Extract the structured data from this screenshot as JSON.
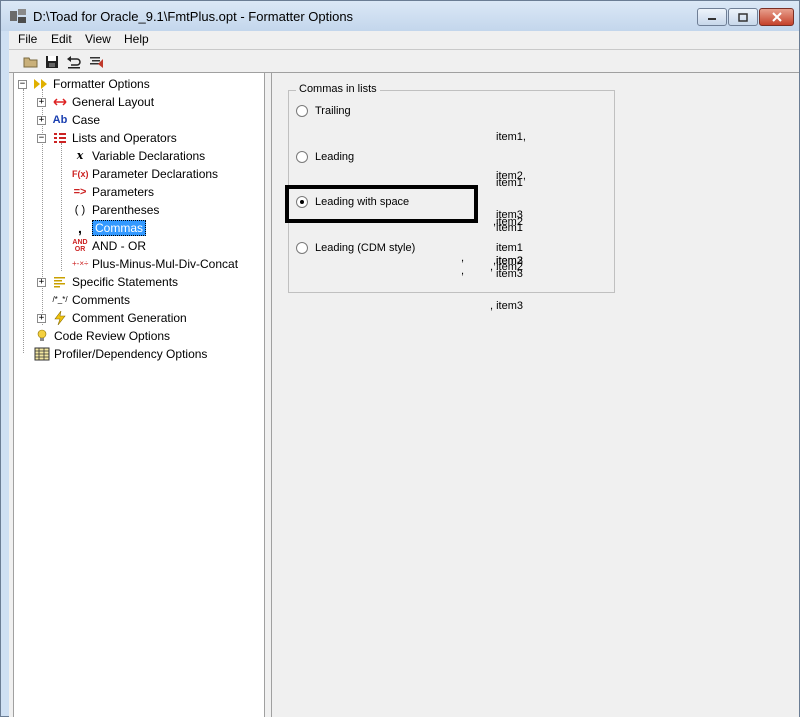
{
  "window": {
    "title": "D:\\Toad for Oracle_9.1\\FmtPlus.opt - Formatter Options"
  },
  "menu": [
    "File",
    "Edit",
    "View",
    "Help"
  ],
  "toolbar": {
    "icons": [
      "open-folder-icon",
      "save-disk-icon",
      "undo-icon",
      "format-icon"
    ]
  },
  "tree": {
    "root": "Formatter Options",
    "general_layout": "General Layout",
    "case": "Case",
    "lists_and_operators": "Lists and Operators",
    "variable_declarations": "Variable Declarations",
    "parameter_declarations": "Parameter Declarations",
    "parameters": "Parameters",
    "parentheses": "Parentheses",
    "commas": "Commas",
    "and_or": "AND - OR",
    "plus_minus": "Plus-Minus-Mul-Div-Concat",
    "specific_statements": "Specific Statements",
    "comments": "Comments",
    "comment_generation": "Comment Generation",
    "code_review": "Code Review Options",
    "profiler": "Profiler/Dependency Options",
    "icon_glyphs": {
      "case": "Ab",
      "variable": "x",
      "parameter_decl": "F(x)",
      "parameters": "=>",
      "parentheses": "( )",
      "commas": ",",
      "and_or_top": "AND",
      "and_or_bottom": "OR",
      "plus": "+-×÷",
      "comments": "/*_*/"
    },
    "selected": "Commas"
  },
  "commas": {
    "group_title": "Commas in lists",
    "options": [
      {
        "label": "Trailing",
        "selected": false,
        "sample": [
          "item1,",
          "item2,",
          "item3"
        ]
      },
      {
        "label": "Leading",
        "selected": false,
        "sample": [
          "item1",
          ",item2",
          ",item3"
        ]
      },
      {
        "label": "Leading with space",
        "selected": true,
        "sample": [
          "item1",
          ", item2",
          ", item3"
        ]
      },
      {
        "label": "Leading (CDM style)",
        "selected": false,
        "sample": [
          "item1",
          ",",
          "item2",
          ",",
          "item3"
        ]
      }
    ]
  },
  "colors": {
    "selection": "#3399ff",
    "highlight_border": "#000000"
  }
}
